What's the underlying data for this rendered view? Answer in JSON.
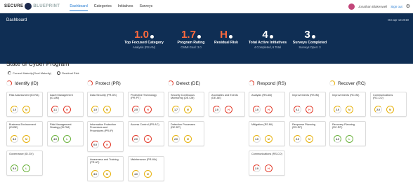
{
  "nav": {
    "logo_a": "SECURE",
    "logo_b": "BLUEPRINT",
    "links": [
      "Dashboard",
      "Categories",
      "Initiatives",
      "Surveys"
    ],
    "user": "Jonathan Blakeswell",
    "signout": "Sign out"
  },
  "banner": {
    "title": "Dashboard",
    "date": "Oct apr 13 2019",
    "stats": [
      {
        "big": "1.0",
        "label": "Top Focused Category",
        "sub": "Analysis (RS AN)",
        "color": "orange"
      },
      {
        "big": "1.7",
        "label": "Program Rating",
        "sub": "CMMI Goal: 3.0",
        "color": "orange"
      },
      {
        "big": "H",
        "label": "Residual Risk",
        "sub": "",
        "color": "orange"
      },
      {
        "big": "4",
        "label": "Total Active Initiatives",
        "sub": "4 Completed, 6 Total",
        "color": "white"
      },
      {
        "big": "3",
        "label": "Surveys Completed",
        "sub": "Surveys Open: 3",
        "color": "white"
      }
    ]
  },
  "program": {
    "title": "State of Cyber Program",
    "legend_a": "Current Maturity(Goal Maturity)",
    "legend_b": "Residual Risk"
  },
  "columns": [
    {
      "title": "Identify (ID)",
      "cards": [
        {
          "name": "Risk Assessment (ID.RA)",
          "lvl": "1.0",
          "risk": "M"
        },
        {
          "name": "Asset Management (ID.AM)",
          "lvl": "1.1",
          "risk": "H"
        },
        {
          "name": "Business Environment (ID.BE)",
          "lvl": "3.0",
          "risk": "M"
        },
        {
          "name": "Risk Management Strategy (ID.RM)",
          "lvl": "4.0",
          "risk": "L"
        },
        {
          "name": "Governance (ID.GV)",
          "lvl": "5.0",
          "risk": "L"
        }
      ]
    },
    {
      "title": "Protect (PR)",
      "cards": [
        {
          "name": "Data Security (PR.DS)",
          "lvl": "1.0",
          "risk": "M"
        },
        {
          "name": "Protective Technology (PR.PT)",
          "lvl": "2.5",
          "risk": "H"
        },
        {
          "name": "Information Protection Processes and Procedures (PR.IP)",
          "lvl": "0.0",
          "risk": "H"
        },
        {
          "name": "Access Control (PR.AC)",
          "lvl": "2.0",
          "risk": "H"
        },
        {
          "name": "Awareness and Training (PR.AT)",
          "lvl": "3.0",
          "risk": "M"
        },
        {
          "name": "Maintenance (PR.MA)",
          "lvl": "4.0",
          "risk": "M"
        }
      ]
    },
    {
      "title": "Detect (DE)",
      "cards": [
        {
          "name": "Security Continuous Monitoring (DE.CM)",
          "lvl": "1.7",
          "risk": "M"
        },
        {
          "name": "Anomalies and Events (DE.AE)",
          "lvl": "2.0",
          "risk": "H"
        },
        {
          "name": "Detection Processes (DE.DP)",
          "lvl": "2.0",
          "risk": "M"
        }
      ]
    },
    {
      "title": "Respond (RS)",
      "cards": [
        {
          "name": "Analysis (RS.AN)",
          "lvl": "1.0",
          "risk": "H"
        },
        {
          "name": "Improvements (RS.IM)",
          "lvl": "0.1",
          "risk": "H"
        },
        {
          "name": "Mitigation (RS.MI)",
          "lvl": "1.0",
          "risk": "M"
        },
        {
          "name": "Response Planning (RS.RP)",
          "lvl": "2.0",
          "risk": "M"
        },
        {
          "name": "Communications (RS.CO)",
          "lvl": "2.0",
          "risk": "H"
        }
      ]
    },
    {
      "title": "Recover (RC)",
      "cards": [
        {
          "name": "Improvements (RC.IM)",
          "lvl": "2.0",
          "risk": "M"
        },
        {
          "name": "Communications (RC.CO)",
          "lvl": "2.0",
          "risk": "M"
        },
        {
          "name": "Recovery Planning (RC.RP)",
          "lvl": "4.0",
          "risk": "L"
        }
      ]
    }
  ]
}
